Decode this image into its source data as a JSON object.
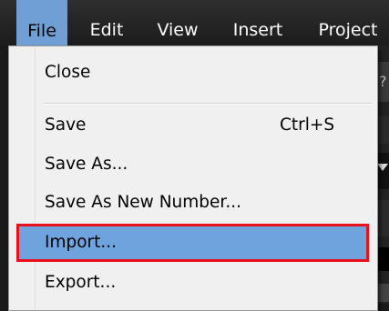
{
  "menubar": {
    "items": [
      "File",
      "Edit",
      "View",
      "Insert",
      "Project"
    ]
  },
  "side_fragment": {
    "glyph": "?"
  },
  "file_menu": {
    "items": [
      {
        "label": "Close",
        "shortcut": ""
      },
      {
        "label": "Save",
        "shortcut": "Ctrl+S"
      },
      {
        "label": "Save As...",
        "shortcut": ""
      },
      {
        "label": "Save As New Number...",
        "shortcut": ""
      },
      {
        "label": "Import...",
        "shortcut": "",
        "highlighted": true
      },
      {
        "label": "Export...",
        "shortcut": ""
      }
    ]
  },
  "colors": {
    "menu_highlight": "#6fa3dd",
    "annotation_box": "#e8101c",
    "menubar_active": "#6f9fd4"
  }
}
